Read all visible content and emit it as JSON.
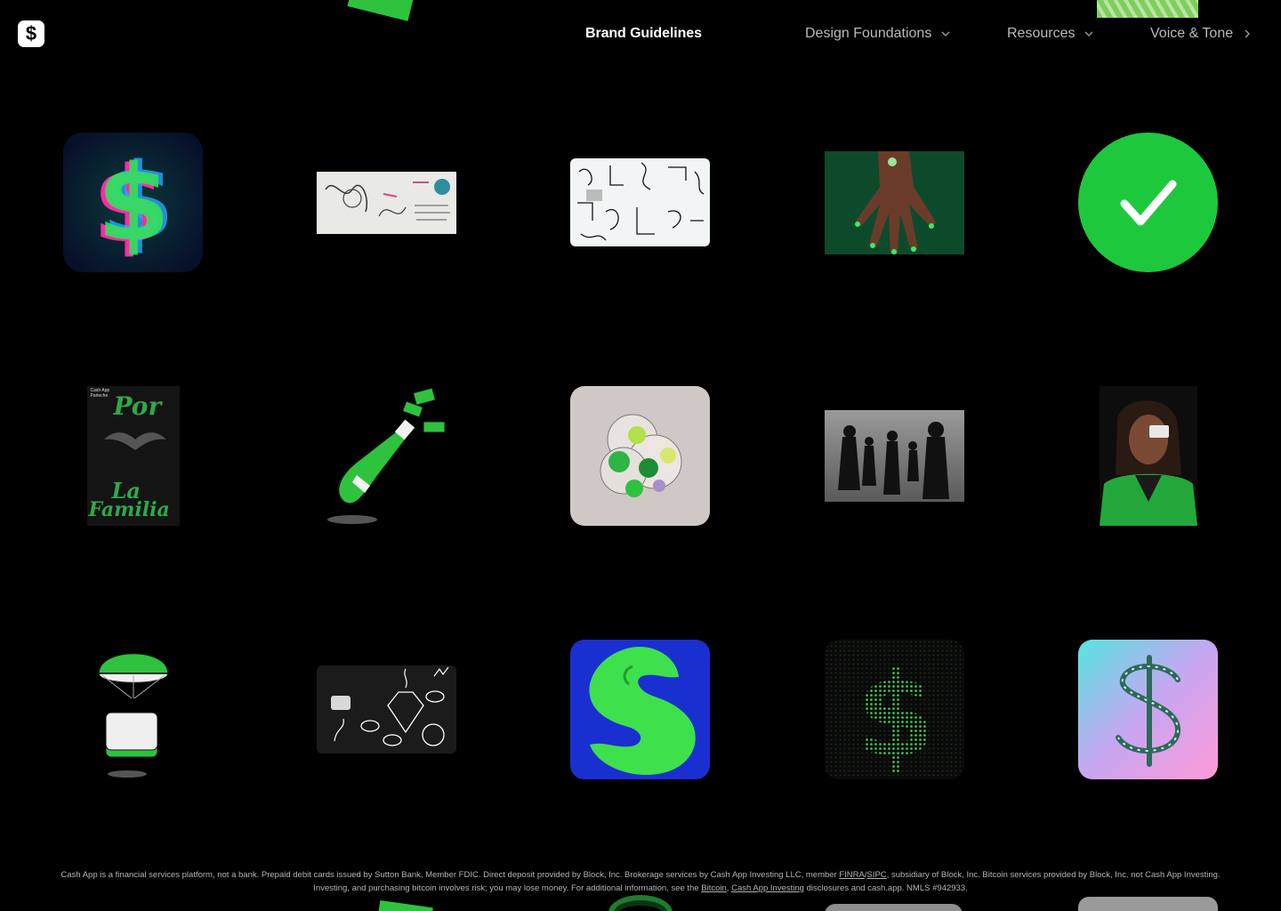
{
  "header": {
    "logo_glyph": "$",
    "title": "Brand Guidelines",
    "nav": [
      {
        "label": "Design Foundations",
        "icon": "chevron-down-icon"
      },
      {
        "label": "Resources",
        "icon": "chevron-down-icon"
      },
      {
        "label": "Voice & Tone",
        "icon": "chevron-right-icon"
      }
    ]
  },
  "tiles": {
    "por": "Por",
    "la": "La",
    "familia": "Familia",
    "badge_small": "Cash App Parleche",
    "check_color": "#1ec83c",
    "brand_green": "#00d632"
  },
  "footer": {
    "text_1": "Cash App is a financial services platform, not a bank. Prepaid debit cards issued by Sutton Bank, Member FDIC. Direct deposit provided by Block, Inc. Brokerage services by Cash App Investing LLC, member ",
    "finra": "FINRA",
    "slash": "/",
    "sipc": "SIPC",
    "text_2": ", subsidiary of Block, Inc. Bitcoin services provided by Block, Inc. not Cash App Investing. Investing, and purchasing bitcoin involves risk; you may lose money. For additional information, see the ",
    "bitcoin": "Bitcoin",
    "comma": ", ",
    "investing": "Cash App Investing",
    "text_3": " disclosures and cash.app. NMLS #942933."
  }
}
